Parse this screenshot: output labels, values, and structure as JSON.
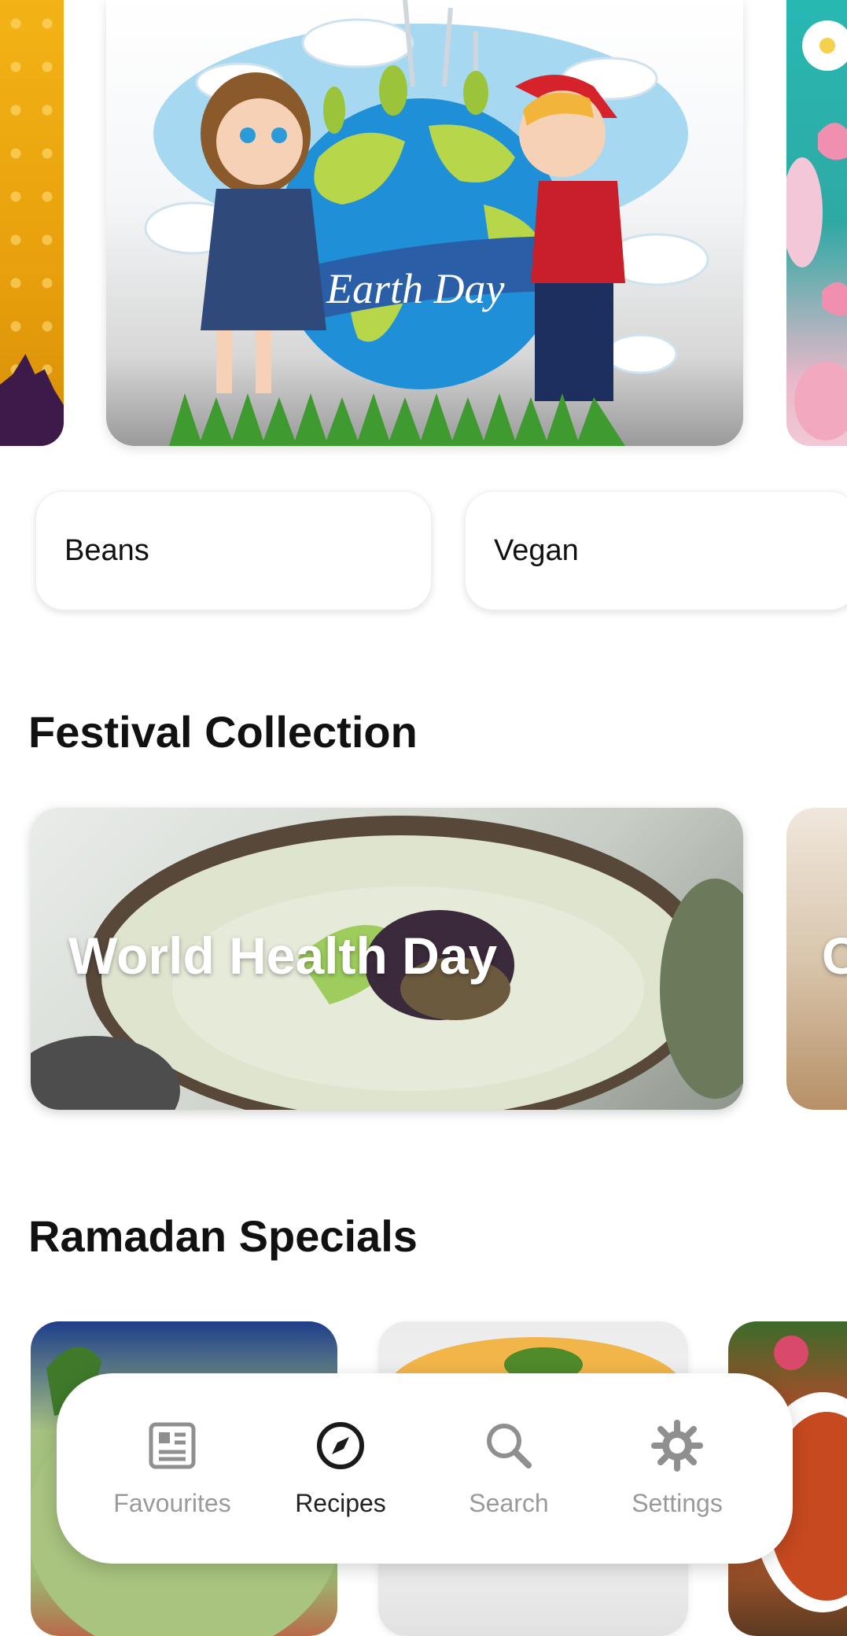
{
  "hero": {
    "main_card_text": "Earth Day"
  },
  "chips": [
    {
      "label": "Beans"
    },
    {
      "label": "Vegan"
    }
  ],
  "festival": {
    "title": "Festival Collection",
    "cards": [
      {
        "title": "World Health Day"
      },
      {
        "title": "C"
      }
    ]
  },
  "ramadan": {
    "title": "Ramadan Specials"
  },
  "nav": {
    "items": [
      {
        "label": "Favourites",
        "icon": "newspaper-icon",
        "active": false
      },
      {
        "label": "Recipes",
        "icon": "compass-icon",
        "active": true
      },
      {
        "label": "Search",
        "icon": "search-icon",
        "active": false
      },
      {
        "label": "Settings",
        "icon": "gear-icon",
        "active": false
      }
    ]
  }
}
